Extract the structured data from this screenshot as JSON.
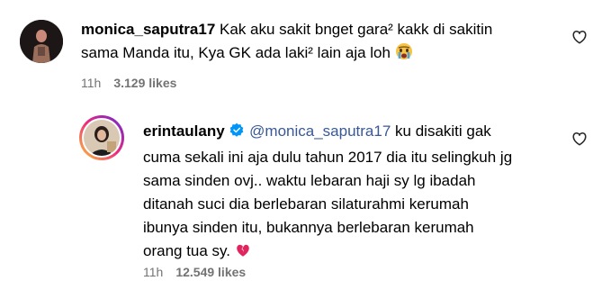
{
  "comments": [
    {
      "username": "monica_saputra17",
      "text_line1": "Kak aku sakit bnget gara² kakk di sakitin",
      "text_line2": "sama Manda itu, Kya GK ada laki² lain aja loh",
      "emoji_icon": "crying-face-icon",
      "time": "11h",
      "likes": "3.129 likes",
      "heart_icon": "heart-outline-icon"
    },
    {
      "username": "erintaulany",
      "verified_icon": "verified-badge-icon",
      "mention": "@monica_saputra17",
      "text_line1_rest": " ku disakiti gak",
      "lines": [
        "cuma sekali ini aja dulu tahun 2017 dia itu selingkuh jg",
        "sama sinden ovj.. waktu lebaran haji sy lg ibadah",
        "ditanah suci dia berlebaran silaturahmi kerumah",
        "ibunya sinden itu, bukannya berlebaran kerumah",
        "orang tua sy."
      ],
      "emoji_icon": "broken-heart-icon",
      "time": "11h",
      "likes": "12.549 likes",
      "heart_icon": "heart-outline-icon"
    }
  ],
  "colors": {
    "text": "#000000",
    "muted": "#737373",
    "mention": "#385898",
    "verified": "#0095f6"
  }
}
